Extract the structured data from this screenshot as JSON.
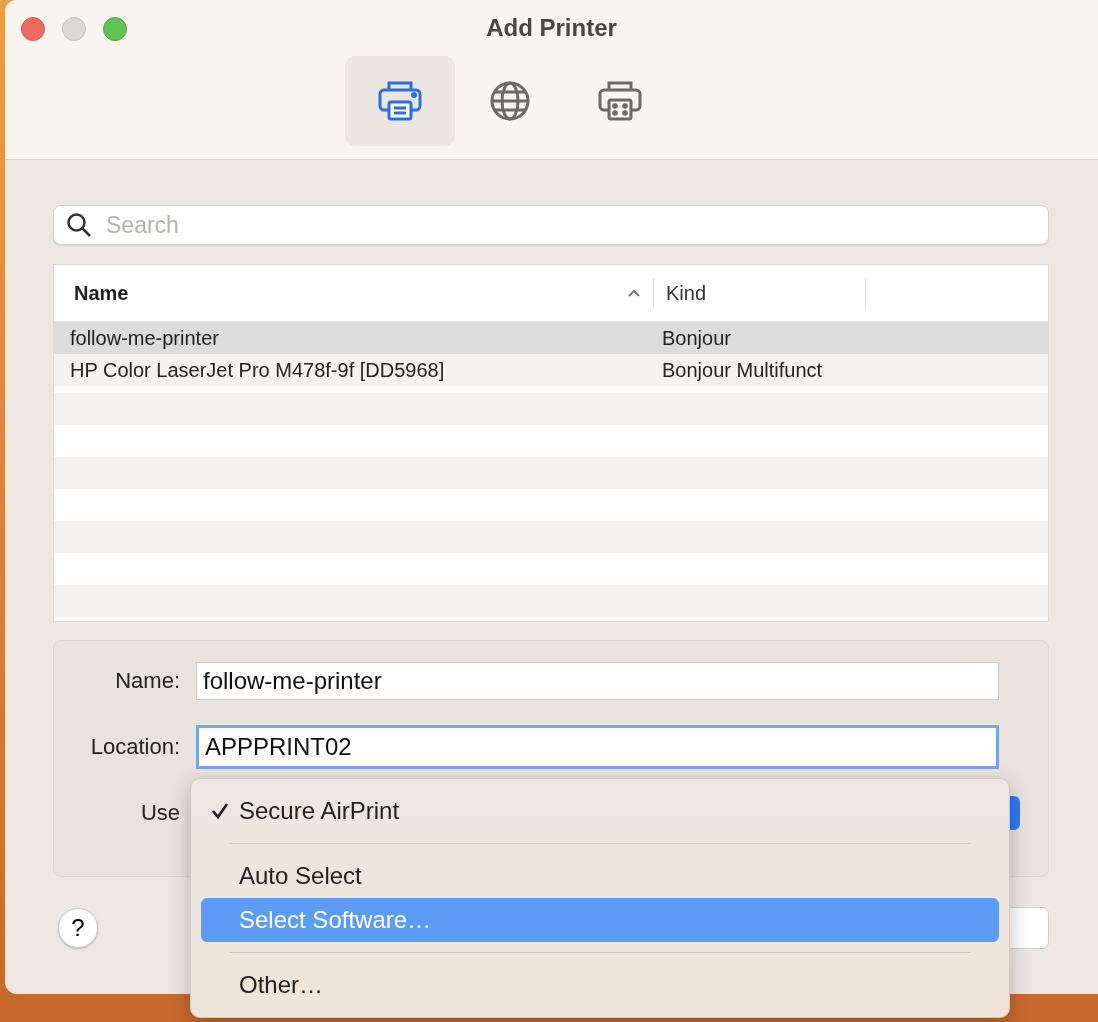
{
  "window": {
    "title": "Add Printer"
  },
  "tabs": [
    {
      "kind": "default",
      "selected": true
    },
    {
      "kind": "ip",
      "selected": false
    },
    {
      "kind": "windows",
      "selected": false
    }
  ],
  "search": {
    "placeholder": "Search"
  },
  "table": {
    "columns": [
      {
        "label": "Name",
        "sorted": true
      },
      {
        "label": "Kind",
        "sorted": false
      }
    ],
    "rows": [
      {
        "name": "follow-me-printer",
        "kind": "Bonjour",
        "selected": true
      },
      {
        "name": "HP Color LaserJet Pro M478f-9f [DD5968]",
        "kind": "Bonjour Multifunct",
        "selected": false
      }
    ]
  },
  "form": {
    "name_label": "Name:",
    "name_value": "follow-me-printer",
    "location_label": "Location:",
    "location_value": "APPPRINT02",
    "use_label": "Use"
  },
  "menu": [
    {
      "kind": "item",
      "label": "Secure AirPrint",
      "checked": true,
      "selected": false
    },
    {
      "kind": "separator"
    },
    {
      "kind": "item",
      "label": "Auto Select",
      "checked": false,
      "selected": false
    },
    {
      "kind": "item",
      "label": "Select Software…",
      "checked": false,
      "selected": true
    },
    {
      "kind": "separator"
    },
    {
      "kind": "item",
      "label": "Other…",
      "checked": false,
      "selected": false
    }
  ],
  "help": {
    "label": "?"
  }
}
